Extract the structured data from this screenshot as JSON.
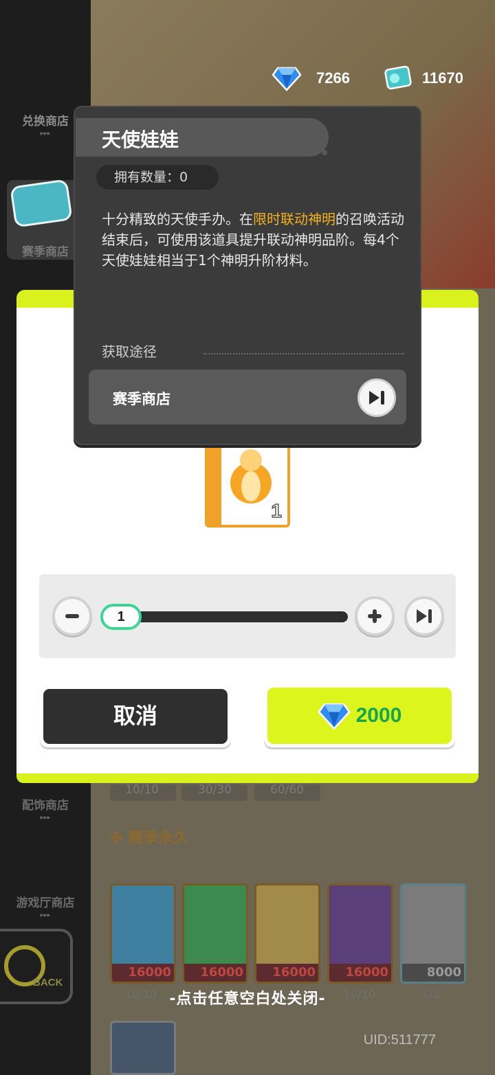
{
  "currencies": {
    "diamonds": "7266",
    "tickets": "11670"
  },
  "sidebar": {
    "items": [
      {
        "label": "兑换商店",
        "arrows": "▸▸▸"
      },
      {
        "label": "赛季商店",
        "arrows": ""
      },
      {
        "label": "配饰商店",
        "arrows": "▸▸▸"
      },
      {
        "label": "游戏厅商店",
        "arrows": "▸▸▸"
      }
    ],
    "back_label": "BACK"
  },
  "item_tooltip": {
    "name": "天使娃娃",
    "owned_label": "拥有数量：0",
    "description_parts": [
      "十分精致的天使手办。在",
      "限时联动神明",
      "的召唤活动结束后，可使用该道具提升联动神明品阶。每4个天使娃娃相当于1个神明升阶材料。"
    ],
    "source_heading": "获取途径",
    "source_name": "赛季商店"
  },
  "purchase": {
    "item_count": "1",
    "quantity": "1",
    "cancel_label": "取消",
    "price": "2000"
  },
  "shop_background": {
    "limits_top": [
      "10/10",
      "30/30",
      "60/60"
    ],
    "section_title": "赛季永久",
    "prices": [
      "16000",
      "16000",
      "16000",
      "16000",
      "8000"
    ],
    "limits_bottom": [
      "10/10",
      "10/10",
      "1/1"
    ]
  },
  "close_hint": "-点击任意空白处关闭-",
  "uid": "UID:511777",
  "colors": {
    "accent_lime": "#d9f21d",
    "price_green": "#16a64f",
    "highlight_orange": "#f4b21c",
    "slider_green": "#3bd693"
  }
}
